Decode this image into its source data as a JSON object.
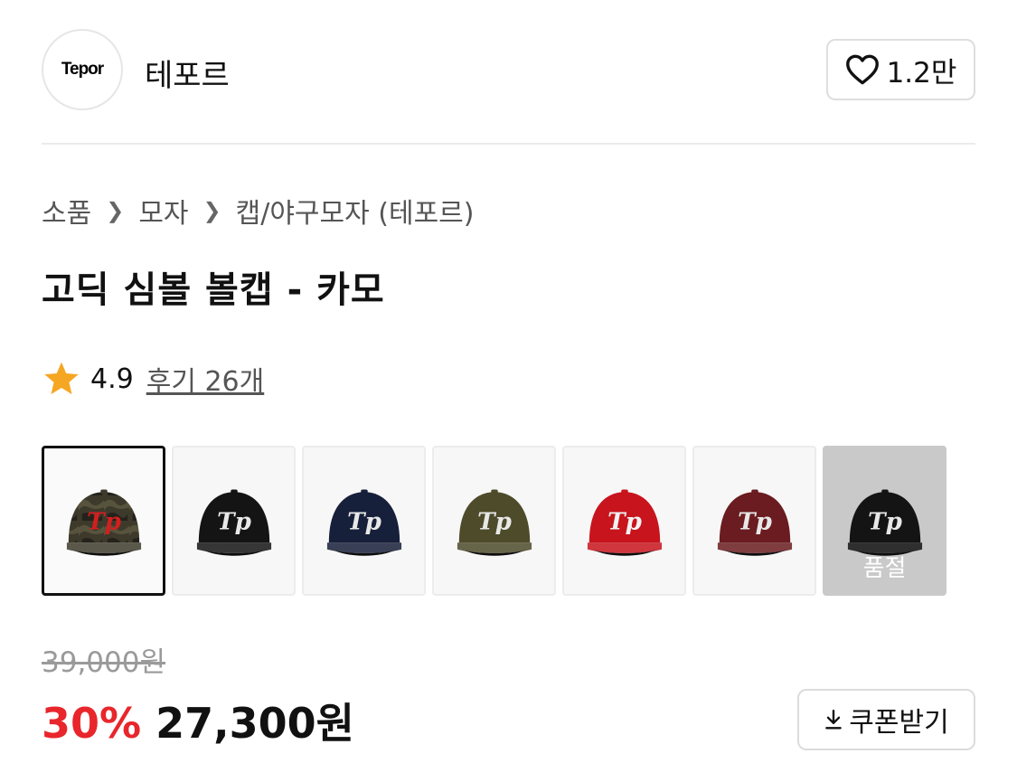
{
  "brand": {
    "logo_text": "Tepor",
    "name": "테포르",
    "likes": "1.2만"
  },
  "breadcrumb": [
    "소품",
    "모자",
    "캡/야구모자 (테포르)"
  ],
  "product": {
    "title": "고딕 심볼 볼캡 - 카모",
    "rating": "4.9",
    "reviews_label": "후기 26개"
  },
  "variants": [
    {
      "color": "camo",
      "cap_color": "#3d3a2c",
      "logo_color": "#d21f1f",
      "selected": true,
      "sold_out": false
    },
    {
      "color": "black",
      "cap_color": "#141414",
      "logo_color": "#e8e8e8",
      "selected": false,
      "sold_out": false
    },
    {
      "color": "navy",
      "cap_color": "#17203a",
      "logo_color": "#e8e8e8",
      "selected": false,
      "sold_out": false
    },
    {
      "color": "khaki",
      "cap_color": "#4d4b2a",
      "logo_color": "#e8e8e8",
      "selected": false,
      "sold_out": false
    },
    {
      "color": "red",
      "cap_color": "#c8141d",
      "logo_color": "#f2f2f2",
      "selected": false,
      "sold_out": false
    },
    {
      "color": "burgundy",
      "cap_color": "#6a1c20",
      "logo_color": "#e8e8e8",
      "selected": false,
      "sold_out": false
    },
    {
      "color": "black",
      "cap_color": "#141414",
      "logo_color": "#e8e8e8",
      "selected": false,
      "sold_out": true
    }
  ],
  "sold_out_label": "품절",
  "price": {
    "original": "39,000원",
    "discount": "30%",
    "sale": "27,300원"
  },
  "coupon_label": "쿠폰받기",
  "colors": {
    "discount_red": "#e8262b",
    "star": "#f5a623"
  }
}
